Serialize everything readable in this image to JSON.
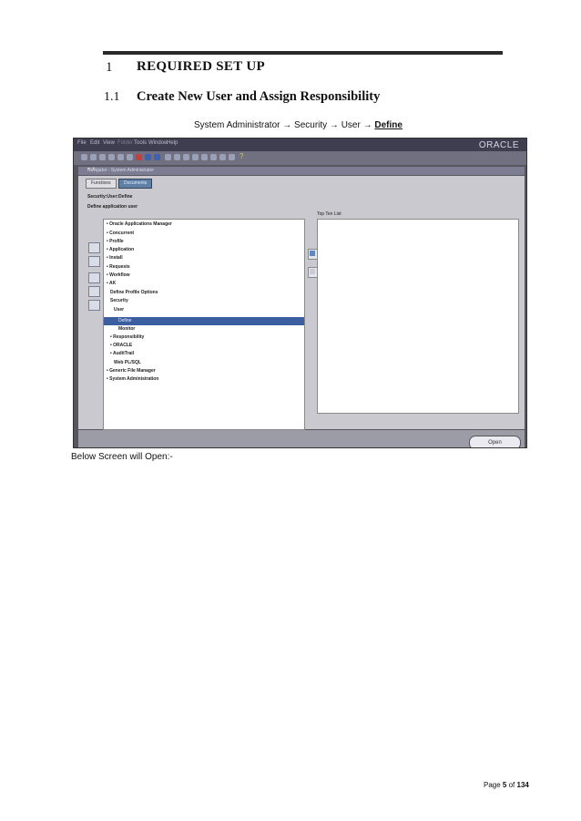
{
  "heading1": {
    "number": "1",
    "text": "REQUIRED SET UP"
  },
  "heading2": {
    "number": "1.1",
    "text": "Create New User and Assign Responsibility"
  },
  "nav_path": {
    "prefix": "System Administrator → Security → User → ",
    "last": "Define"
  },
  "screenshot": {
    "menu": [
      "File",
      "Edit",
      "View",
      "Folder",
      "Tools",
      "Window",
      "Help"
    ],
    "logo": "ORACLE",
    "help_icon": "?",
    "navigator_title": "Navigator - System Administrator",
    "close_glyph": "≈ ×",
    "tabs": [
      "Functions",
      "Documents"
    ],
    "breadcrumb": "Security:User:Define",
    "subtitle": "Define application user",
    "tree": [
      "• Oracle Applications Manager",
      "• Concurrent",
      "• Profile",
      "• Application",
      "• Install",
      "• Requests",
      "• Workflow",
      "• AK",
      "Define Profile Options",
      "Security",
      "User",
      "Monitor",
      "• Responsibility",
      "• ORACLE",
      "• AuditTrail",
      "Web PL/SQL",
      "• Generic File Manager",
      "• System Administration"
    ],
    "selected_item": "Define",
    "top_ten_label": "Top Ten List",
    "open_button": "Open"
  },
  "below_text": "Below Screen will Open:-",
  "footer": {
    "page_word": "Page",
    "page": "5",
    "of_word": "of",
    "total": "134"
  }
}
